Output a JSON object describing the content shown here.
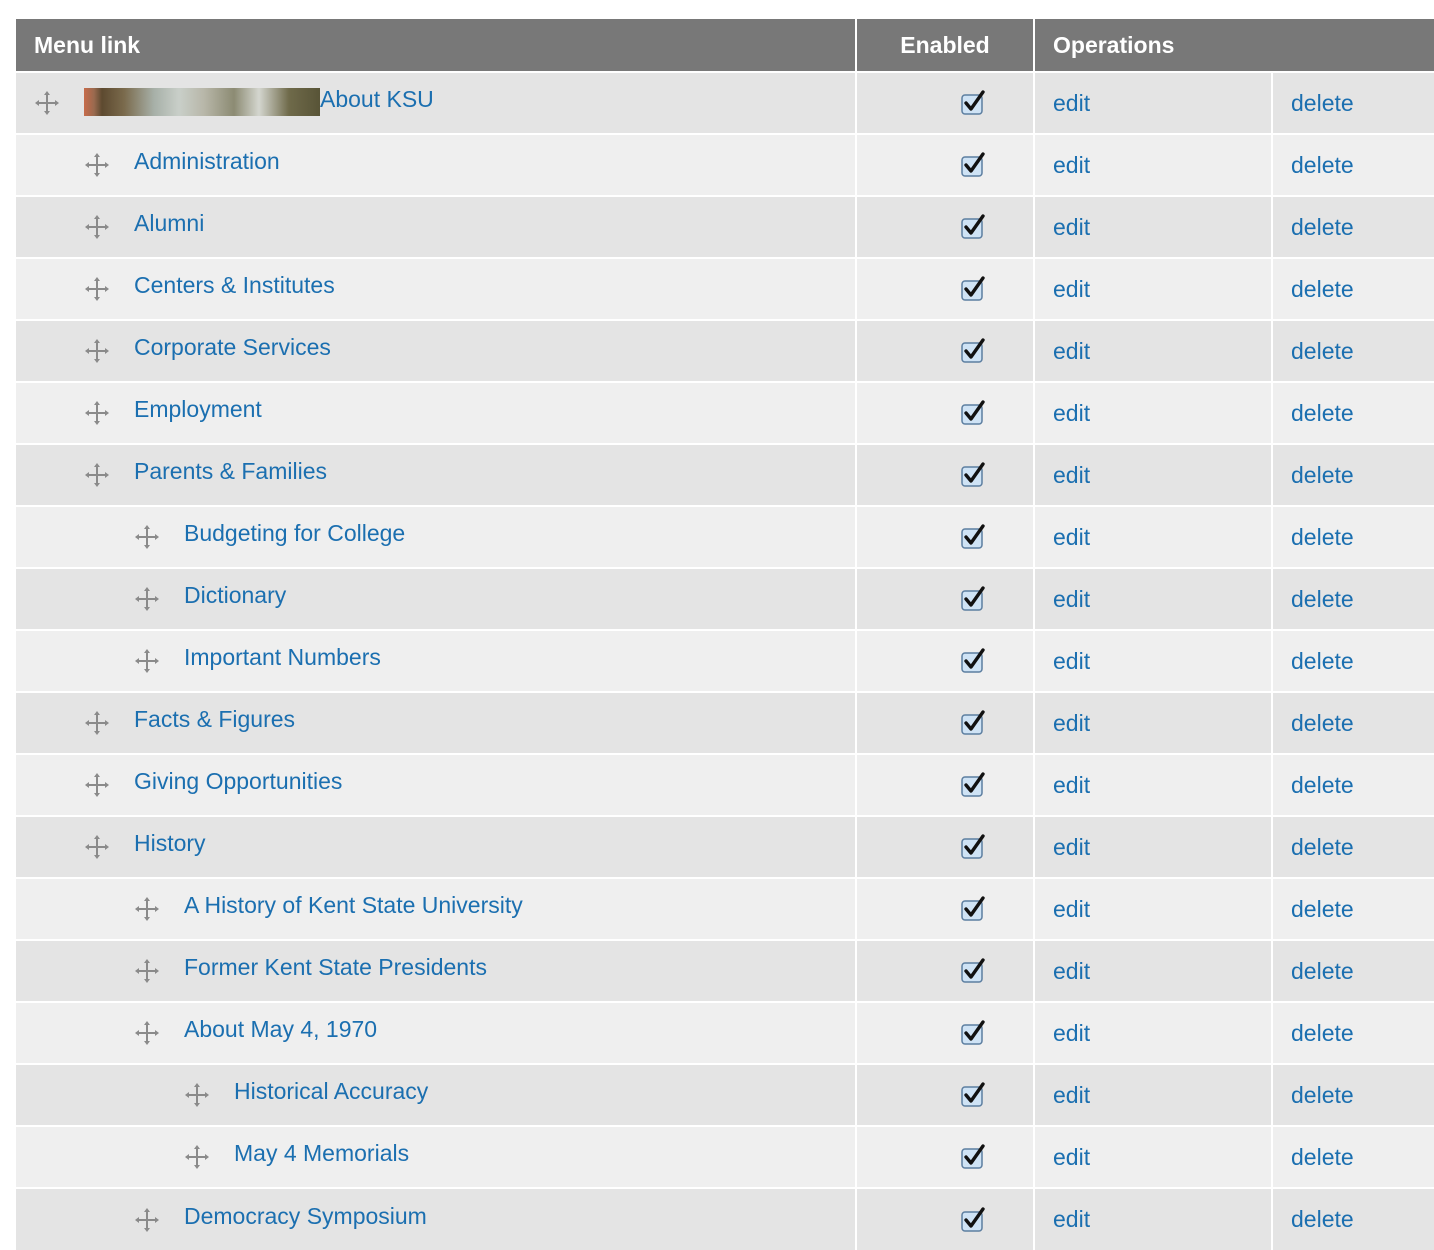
{
  "header": {
    "menu_link": "Menu link",
    "enabled": "Enabled",
    "operations": "Operations"
  },
  "colors": {
    "header_bg": "#787878",
    "link": "#1b6fb0",
    "row_odd": "#e4e4e4",
    "row_even": "#efefef"
  },
  "rows": [
    {
      "title": "About KSU",
      "depth": 0,
      "has_thumbnail": true,
      "enabled": true,
      "edit": "edit",
      "delete": "delete"
    },
    {
      "title": "Administration",
      "depth": 1,
      "enabled": true,
      "edit": "edit",
      "delete": "delete"
    },
    {
      "title": "Alumni",
      "depth": 1,
      "enabled": true,
      "edit": "edit",
      "delete": "delete"
    },
    {
      "title": "Centers & Institutes",
      "depth": 1,
      "enabled": true,
      "edit": "edit",
      "delete": "delete"
    },
    {
      "title": "Corporate Services",
      "depth": 1,
      "enabled": true,
      "edit": "edit",
      "delete": "delete"
    },
    {
      "title": "Employment",
      "depth": 1,
      "enabled": true,
      "edit": "edit",
      "delete": "delete"
    },
    {
      "title": "Parents & Families",
      "depth": 1,
      "enabled": true,
      "edit": "edit",
      "delete": "delete"
    },
    {
      "title": "Budgeting for College",
      "depth": 2,
      "enabled": true,
      "edit": "edit",
      "delete": "delete"
    },
    {
      "title": "Dictionary",
      "depth": 2,
      "enabled": true,
      "edit": "edit",
      "delete": "delete"
    },
    {
      "title": "Important Numbers",
      "depth": 2,
      "enabled": true,
      "edit": "edit",
      "delete": "delete"
    },
    {
      "title": "Facts & Figures",
      "depth": 1,
      "enabled": true,
      "edit": "edit",
      "delete": "delete"
    },
    {
      "title": "Giving Opportunities",
      "depth": 1,
      "enabled": true,
      "edit": "edit",
      "delete": "delete"
    },
    {
      "title": "History",
      "depth": 1,
      "enabled": true,
      "edit": "edit",
      "delete": "delete"
    },
    {
      "title": "A History of Kent State University",
      "depth": 2,
      "enabled": true,
      "edit": "edit",
      "delete": "delete"
    },
    {
      "title": "Former Kent State Presidents",
      "depth": 2,
      "enabled": true,
      "edit": "edit",
      "delete": "delete"
    },
    {
      "title": "About May 4, 1970",
      "depth": 2,
      "enabled": true,
      "edit": "edit",
      "delete": "delete"
    },
    {
      "title": "Historical Accuracy",
      "depth": 3,
      "enabled": true,
      "edit": "edit",
      "delete": "delete"
    },
    {
      "title": "May 4 Memorials",
      "depth": 3,
      "enabled": true,
      "edit": "edit",
      "delete": "delete"
    },
    {
      "title": "Democracy Symposium",
      "depth": 2,
      "enabled": true,
      "edit": "edit",
      "delete": "delete"
    }
  ]
}
